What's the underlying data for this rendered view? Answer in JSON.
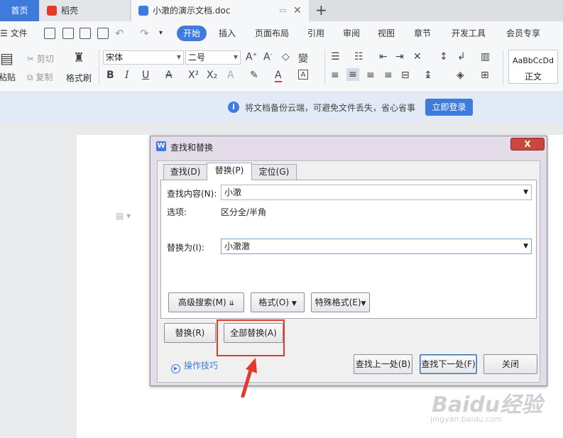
{
  "tabs": {
    "home": "首页",
    "daoke": "稻壳",
    "doc": "小澈的演示文档.doc",
    "add": "+"
  },
  "menu": {
    "file": "文件",
    "items": [
      "开始",
      "插入",
      "页面布局",
      "引用",
      "审阅",
      "视图",
      "章节",
      "开发工具",
      "会员专享"
    ]
  },
  "ribbon": {
    "cut": "剪切",
    "copy": "复制",
    "paste": "粘贴",
    "format_painter": "格式刷",
    "font_name": "宋体",
    "font_size": "二号",
    "style_preview": "AaBbCcDd",
    "style_name": "正文"
  },
  "notify": {
    "text": "将文档备份云端，可避免文件丢失，省心省事",
    "button": "立即登录"
  },
  "dialog": {
    "title": "查找和替换",
    "close": "X",
    "tabs": [
      "查找(D)",
      "替换(P)",
      "定位(G)"
    ],
    "find_label": "查找内容(N):",
    "find_value": "小澈",
    "options_label": "选项:",
    "options_value": "区分全/半角",
    "replace_label": "替换为(I):",
    "replace_value": "小澈澈",
    "advanced_search": "高级搜索(M)",
    "format": "格式(O)",
    "special_format": "特殊格式(E)",
    "replace_btn": "替换(R)",
    "replace_all_btn": "全部替换(A)",
    "tips": "操作技巧",
    "find_prev": "查找上一处(B)",
    "find_next": "查找下一处(F)",
    "close_btn": "关闭"
  },
  "watermark": {
    "brand": "Baidu经验",
    "url": "jingyan.baidu.com"
  },
  "colors": {
    "accent": "#3e7bdc",
    "highlight": "#e23a2c"
  }
}
